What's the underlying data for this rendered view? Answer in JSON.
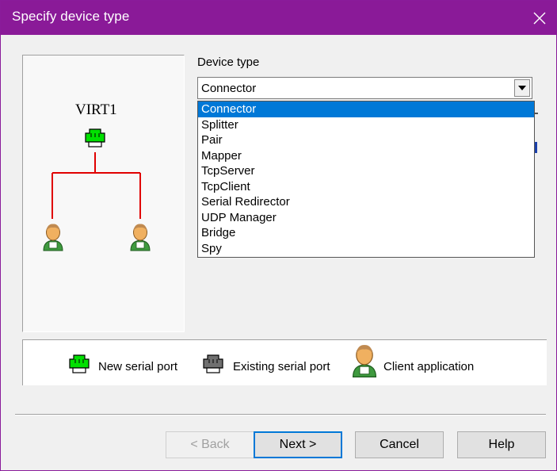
{
  "window": {
    "title": "Specify device type",
    "title_bar_color": "#8a1a98",
    "close_icon": "close-icon"
  },
  "diagram": {
    "device_name": "VIRT1",
    "device_icon": "serial-port-new-icon",
    "device_color": "#00e000",
    "link_color": "#e00000",
    "clients": [
      "client-application-icon",
      "client-application-icon"
    ]
  },
  "device_type": {
    "label": "Device type",
    "selected": "Connector",
    "options": [
      "Connector",
      "Splitter",
      "Pair",
      "Mapper",
      "TcpServer",
      "TcpClient",
      "Serial Redirector",
      "UDP Manager",
      "Bridge",
      "Spy"
    ],
    "selected_index": 0,
    "selection_color": "#0078d7"
  },
  "legend": {
    "new_serial_port": "New serial port",
    "existing_serial_port": "Existing serial port",
    "client_application": "Client application"
  },
  "buttons": {
    "back": "< Back",
    "next": "Next >",
    "cancel": "Cancel",
    "help": "Help"
  }
}
